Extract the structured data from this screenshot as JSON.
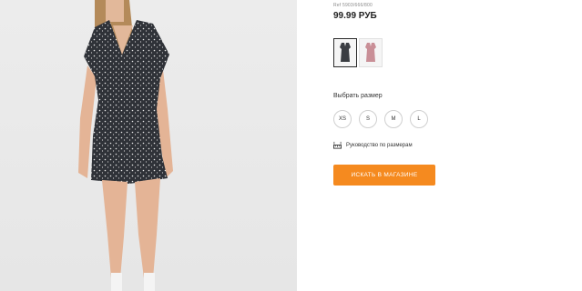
{
  "product": {
    "ref": "Ref 5903/666/800",
    "price": "99.99 РУБ"
  },
  "colors": [
    {
      "name": "black-floral",
      "selected": true,
      "hex": "#3a3d42"
    },
    {
      "name": "pink-floral",
      "selected": false,
      "hex": "#c98f97"
    }
  ],
  "sizes": {
    "label": "Выбрать размер",
    "options": [
      "XS",
      "S",
      "M",
      "L"
    ]
  },
  "guide": {
    "icon": "ruler-icon",
    "label": "Руководство по размерам"
  },
  "cta": {
    "label": "ИСКАТЬ В МАГАЗИНЕ",
    "color": "#f58a1f"
  }
}
